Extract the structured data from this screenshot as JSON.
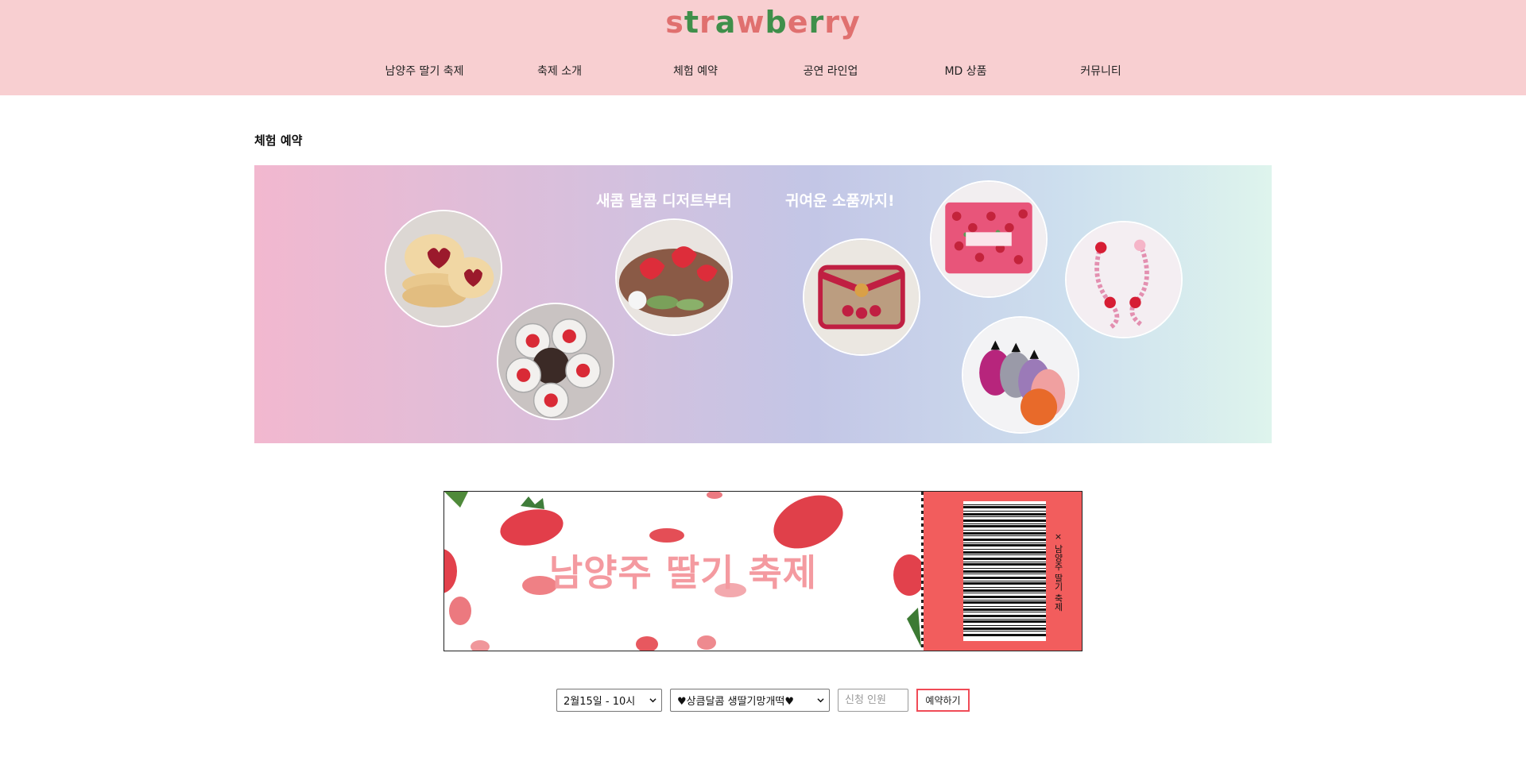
{
  "header": {
    "logo_letters": [
      {
        "ch": "s",
        "color": "#e0706f"
      },
      {
        "ch": "t",
        "color": "#3f8f4a"
      },
      {
        "ch": "r",
        "color": "#e0706f"
      },
      {
        "ch": "a",
        "color": "#3f8f4a"
      },
      {
        "ch": "w",
        "color": "#e0706f"
      },
      {
        "ch": "b",
        "color": "#3f8f4a"
      },
      {
        "ch": "e",
        "color": "#e0706f"
      },
      {
        "ch": "r",
        "color": "#3f8f4a"
      },
      {
        "ch": "r",
        "color": "#e0706f"
      },
      {
        "ch": "y",
        "color": "#e0706f"
      }
    ],
    "logo_leaf_color": "#3f8f4a",
    "background": "#f8cfd1"
  },
  "nav": {
    "items": [
      {
        "label": "남양주 딸기 축제"
      },
      {
        "label": "축제 소개"
      },
      {
        "label": "체험 예약"
      },
      {
        "label": "공연 라인업"
      },
      {
        "label": "MD 상품"
      },
      {
        "label": "커뮤니티"
      }
    ]
  },
  "page": {
    "title": "체험 예약"
  },
  "banner": {
    "caption_left": "새콤 달콤 디저트부터",
    "caption_right": "귀여운 소품까지!",
    "images": [
      {
        "name": "heart-cookie-image",
        "subject": "heart jam cookies"
      },
      {
        "name": "strawberry-cups-image",
        "subject": "strawberry dessert cups"
      },
      {
        "name": "strawberry-mochi-image",
        "subject": "strawberry rice cakes"
      },
      {
        "name": "knit-card-case-image",
        "subject": "crochet card case"
      },
      {
        "name": "strawberry-pouch-image",
        "subject": "strawberry print pouch"
      },
      {
        "name": "beaded-earrings-image",
        "subject": "beaded strawberry earrings"
      },
      {
        "name": "knit-strawberry-keyrings-image",
        "subject": "crochet strawberry keyrings"
      }
    ]
  },
  "ticket": {
    "title": "남양주 딸기 축제",
    "stub_text": "× 남양주 딸기 축제",
    "stub_color": "#f25d5d",
    "title_color": "#f49aa0"
  },
  "form": {
    "date_select": {
      "value": "2월15일 - 10시"
    },
    "program_select": {
      "value": "♥상큼달콤 생딸기망개떡♥"
    },
    "people_input": {
      "placeholder": "신청 인원",
      "value": ""
    },
    "submit_label": "예약하기",
    "submit_border_color": "#f04b57"
  }
}
